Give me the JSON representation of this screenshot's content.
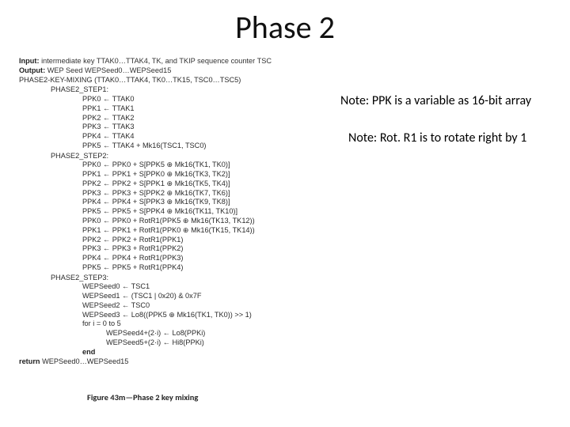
{
  "title": "Phase 2",
  "notes": {
    "n1": "Note: PPK is a variable as 16-bit array",
    "n2": "Note: Rot. R1 is to rotate right by 1"
  },
  "algo": {
    "input": "Input: intermediate key TTAK0…TTAK4, TK, and TKIP sequence counter TSC",
    "output": "Output: WEP Seed WEPSeed0…WEPSeed15",
    "call": "PHASE2-KEY-MIXING (TTAK0…TTAK4, TK0…TK15, TSC0…TSC5)",
    "step1_label": "PHASE2_STEP1:",
    "step1": [
      "PPK0 ← TTAK0",
      "PPK1 ← TTAK1",
      "PPK2 ← TTAK2",
      "PPK3 ← TTAK3",
      "PPK4 ← TTAK4",
      "PPK5 ← TTAK4 + Mk16(TSC1, TSC0)"
    ],
    "step2_label": "PHASE2_STEP2:",
    "step2": [
      "PPK0 ← PPK0 + S[PPK5 ⊕ Mk16(TK1, TK0)]",
      "PPK1 ← PPK1 + S[PPK0 ⊕ Mk16(TK3, TK2)]",
      "PPK2 ← PPK2 + S[PPK1 ⊕ Mk16(TK5, TK4)]",
      "PPK3 ← PPK3 + S[PPK2 ⊕ Mk16(TK7, TK6)]",
      "PPK4 ← PPK4 + S[PPK3 ⊕ Mk16(TK9, TK8)]",
      "PPK5 ← PPK5 + S[PPK4 ⊕ Mk16(TK11, TK10)]",
      "PPK0 ← PPK0 + RotR1(PPK5 ⊕ Mk16(TK13, TK12))",
      "PPK1 ← PPK1 + RotR1(PPK0 ⊕ Mk16(TK15, TK14))",
      "PPK2 ← PPK2 + RotR1(PPK1)",
      "PPK3 ← PPK3 + RotR1(PPK2)",
      "PPK4 ← PPK4 + RotR1(PPK3)",
      "PPK5 ← PPK5 + RotR1(PPK4)"
    ],
    "step3_label": "PHASE2_STEP3:",
    "step3": [
      "WEPSeed0 ← TSC1",
      "WEPSeed1 ← (TSC1 | 0x20) & 0x7F",
      "WEPSeed2 ← TSC0",
      "WEPSeed3 ← Lo8((PPK5 ⊕ Mk16(TK1, TK0)) >> 1)",
      "for i = 0 to 5"
    ],
    "step3_loop": [
      "WEPSeed4+(2·i) ← Lo8(PPKi)",
      "WEPSeed5+(2·i) ← Hi8(PPKi)"
    ],
    "end_kw": "end",
    "return_kw": "return ",
    "return_val": "WEPSeed0…WEPSeed15"
  },
  "figure_caption": {
    "bold": "Figure 43m—Phase 2 key mixing",
    "rest": ""
  }
}
